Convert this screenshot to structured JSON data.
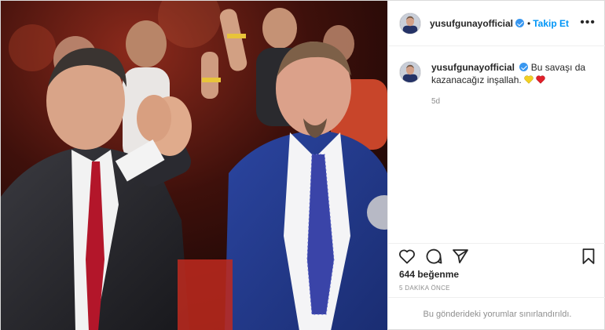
{
  "post": {
    "image_alt": "Two men at a celebration, one applauding",
    "header": {
      "username": "yusufgunayofficial",
      "verified": true,
      "separator": "•",
      "follow_label": "Takip Et",
      "more_label": "•••"
    },
    "caption": {
      "username": "yusufgunayofficial",
      "text": "Bu savaşı da kazanacağız inşallah.",
      "emojis": [
        "yellow-heart",
        "red-heart"
      ],
      "time": "5d"
    },
    "actions": {
      "like_icon": "heart-outline-icon",
      "comment_icon": "comment-bubble-icon",
      "share_icon": "paper-plane-icon",
      "save_icon": "bookmark-icon"
    },
    "likes": "644 beğenme",
    "timestamp": "5 DAKİKA ÖNCE",
    "comments_limited": "Bu gönderideki yorumlar sınırlandırıldı.",
    "colors": {
      "link_blue": "#0095f6",
      "verified_blue": "#3897f0",
      "muted": "#8e8e8e",
      "border": "#dbdbdb"
    }
  }
}
